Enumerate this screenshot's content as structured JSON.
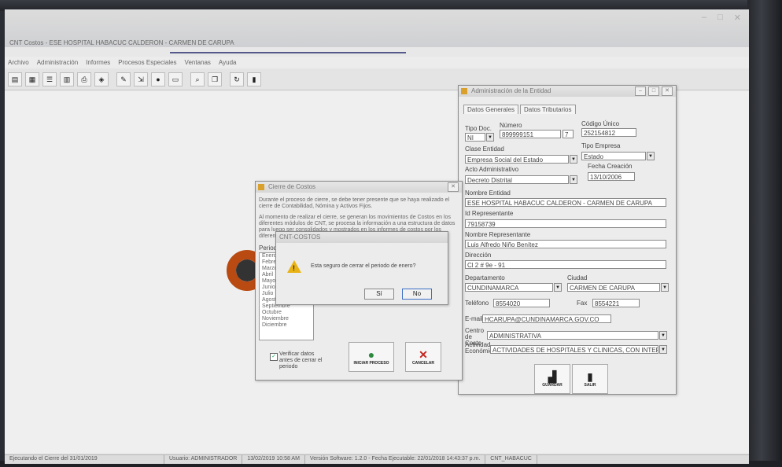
{
  "app": {
    "title": "CNT Costos - ESE HOSPITAL HABACUC CALDERON - CARMEN DE CARUPA",
    "window_controls": [
      "–",
      "□",
      "✕"
    ]
  },
  "menu": [
    "Archivo",
    "Administración",
    "Informes",
    "Procesos Especiales",
    "Ventanas",
    "Ayuda"
  ],
  "toolbar_icons": [
    "folder-icon",
    "grid-icon",
    "list-icon",
    "report-icon",
    "print-icon",
    "gift-icon",
    "tools-icon",
    "export-icon",
    "traffic-light-icon",
    "notes-icon",
    "search-icon",
    "copy-icon",
    "refresh-icon",
    "door-exit-icon"
  ],
  "entity_form": {
    "title": "Administración de la Entidad",
    "tabs": [
      "Datos Generales",
      "Datos Tributarios"
    ],
    "tipo_doc_label": "Tipo Doc.",
    "tipo_doc_value": "NI",
    "numero_label": "Número",
    "numero_value": "899999151",
    "numero_dv": "7",
    "codigo_label": "Código Único",
    "codigo_value": "252154812",
    "clase_label": "Clase Entidad",
    "clase_value": "Empresa Social del Estado",
    "tipo_empresa_label": "Tipo Empresa",
    "tipo_empresa_value": "Estado",
    "acto_label": "Acto Administrativo",
    "acto_value": "Decreto Distrital",
    "fecha_label": "Fecha Creación",
    "fecha_value": "13/10/2006",
    "nombre_label": "Nombre Entidad",
    "nombre_value": "ESE HOSPITAL HABACUC CALDERON - CARMEN DE CARUPA",
    "id_rep_label": "Id Representante",
    "id_rep_value": "79158739",
    "nombre_rep_label": "Nombre Representante",
    "nombre_rep_value": "Luis Alfredo Niño Benítez",
    "direccion_label": "Dirección",
    "direccion_value": "Cl 2 # 9e - 91",
    "depto_label": "Departamento",
    "depto_value": "CUNDINAMARCA",
    "ciudad_label": "Ciudad",
    "ciudad_value": "CARMEN DE CARUPA",
    "telefono_label": "Teléfono",
    "telefono_value": "8554020",
    "fax_label": "Fax",
    "fax_value": "8554221",
    "email_label": "E-mail",
    "email_value": "HCARUPA@CUNDINAMARCA.GOV.CO",
    "centro_label": "Centro de Costo",
    "centro_value": "ADMINISTRATIVA",
    "actividad_label": "Actividad Económica",
    "actividad_value": "ACTIVIDADES DE HOSPITALES Y CLINICAS, CON INTERNA",
    "guardar_label": "GUARDAR",
    "salir_label": "SALIR"
  },
  "cierre_window": {
    "title": "Cierre de Costos",
    "paragraph1": "Durante el proceso de cierre, se debe tener presente que se haya realizado el cierre de Contabilidad, Nómina y Activos Fijos.",
    "paragraph2": "Al momento de realizar el cierre, se generan los movimientos de Costos en los diferentes módulos de CNT, se procesa la información a una estructura de datos para luego ser consolidados y mostrados en los informes de costos por los diferentes periodos.",
    "periodo_label": "Periodo",
    "months": [
      "Enero",
      "Febrero",
      "Marzo",
      "Abril",
      "Mayo",
      "Junio",
      "Julio",
      "Agosto",
      "Septiembre",
      "Octubre",
      "Noviembre",
      "Diciembre"
    ],
    "checkbox_label": "Verificar datos antes de cerrar el periodo",
    "iniciar_label": "INICIAR PROCESO",
    "cancelar_label": "CANCELAR"
  },
  "confirm_dialog": {
    "title": "CNT-COSTOS",
    "message": "Esta seguro de cerrar el periodo de enero?",
    "yes_label": "Sí",
    "no_label": "No"
  },
  "statusbar": [
    "Ejecutando el Cierre del 31/01/2019",
    "Usuario: ADMINISTRADOR",
    "13/02/2019 10:58 AM",
    "Versión Software: 1.2.0 - Fecha Ejecutable: 22/01/2018 14:43:37 p.m.",
    "CNT_HABACUC"
  ],
  "colors": {
    "accent_bar": "#555a8a",
    "logo": "#b84a12",
    "warning": "#e9b316"
  }
}
